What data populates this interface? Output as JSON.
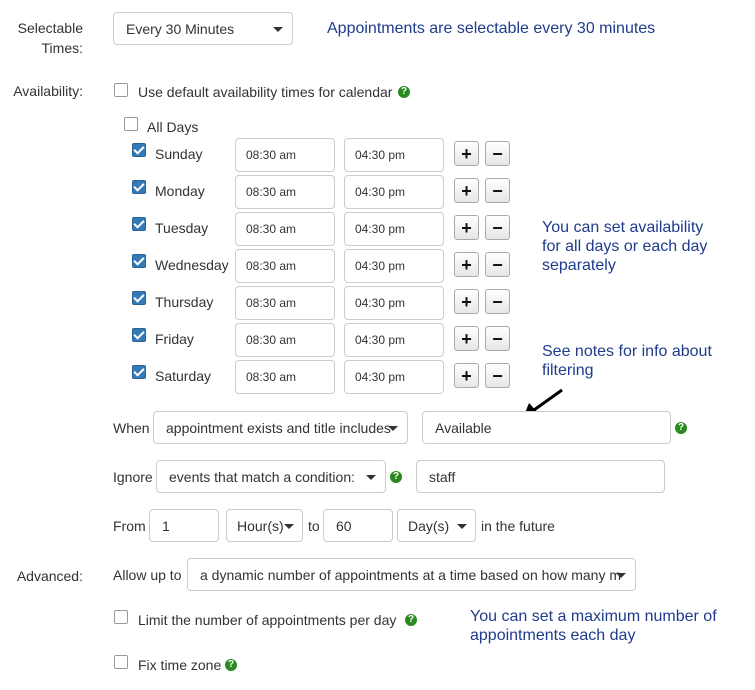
{
  "selectable": {
    "label": "Selectable Times:",
    "value": "Every 30 Minutes",
    "note": "Appointments are selectable every 30 minutes"
  },
  "availability": {
    "label": "Availability:",
    "use_default_label": "Use default availability times for calendar",
    "use_default_checked": false,
    "all_days_label": "All Days",
    "all_days_checked": false,
    "days": [
      {
        "name": "Sunday",
        "checked": true,
        "start": "08:30 am",
        "end": "04:30 pm"
      },
      {
        "name": "Monday",
        "checked": true,
        "start": "08:30 am",
        "end": "04:30 pm"
      },
      {
        "name": "Tuesday",
        "checked": true,
        "start": "08:30 am",
        "end": "04:30 pm"
      },
      {
        "name": "Wednesday",
        "checked": true,
        "start": "08:30 am",
        "end": "04:30 pm"
      },
      {
        "name": "Thursday",
        "checked": true,
        "start": "08:30 am",
        "end": "04:30 pm"
      },
      {
        "name": "Friday",
        "checked": true,
        "start": "08:30 am",
        "end": "04:30 pm"
      },
      {
        "name": "Saturday",
        "checked": true,
        "start": "08:30 am",
        "end": "04:30 pm"
      }
    ],
    "plus": "+",
    "minus": "−",
    "note_days": "You can set availability for all days or each day separately",
    "note_filter": "See notes for info about filtering"
  },
  "when": {
    "label": "When",
    "condition": "appointment exists and title includes",
    "value": "Available"
  },
  "ignore": {
    "label": "Ignore",
    "condition": "events that match a condition:",
    "value": "staff"
  },
  "range": {
    "from_label": "From",
    "from_value": "1",
    "from_unit": "Hour(s)",
    "to_label": "to",
    "to_value": "60",
    "to_unit": "Day(s)",
    "suffix": "in the future"
  },
  "advanced": {
    "label": "Advanced:",
    "allow_label": "Allow up to",
    "allow_value": "a dynamic number of appointments at a time based on how many m",
    "limit_label": "Limit the number of appointments per day",
    "limit_checked": false,
    "fix_tz_label": "Fix time zone",
    "fix_tz_checked": false,
    "note": "You can set a maximum number of appointments each day"
  },
  "icons": {
    "help": "?"
  },
  "colors": {
    "note": "#1f3b8c",
    "help": "#2a8a1f",
    "checkbox": "#337ab7"
  }
}
